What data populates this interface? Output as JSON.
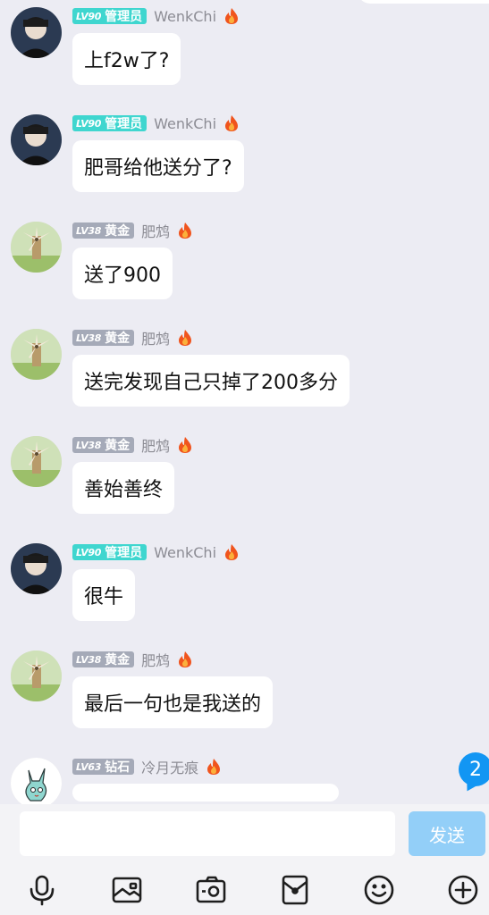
{
  "messages": [
    {
      "level": "LV90",
      "title": "管理员",
      "nickname": "WenkChi",
      "text": "上f2w了?",
      "type": "admin"
    },
    {
      "level": "LV90",
      "title": "管理员",
      "nickname": "WenkChi",
      "text": "肥哥给他送分了?",
      "type": "admin"
    },
    {
      "level": "LV38",
      "title": "黄金",
      "nickname": "肥鸩",
      "text": "送了900",
      "type": "gold"
    },
    {
      "level": "LV38",
      "title": "黄金",
      "nickname": "肥鸩",
      "text": "送完发现自己只掉了200多分",
      "type": "gold"
    },
    {
      "level": "LV38",
      "title": "黄金",
      "nickname": "肥鸩",
      "text": "善始善终",
      "type": "gold"
    },
    {
      "level": "LV90",
      "title": "管理员",
      "nickname": "WenkChi",
      "text": "很牛",
      "type": "admin"
    },
    {
      "level": "LV38",
      "title": "黄金",
      "nickname": "肥鸩",
      "text": "最后一句也是我送的",
      "type": "gold"
    },
    {
      "level": "LV63",
      "title": "钻石",
      "nickname": "冷月无痕",
      "text": "",
      "type": "diamond"
    }
  ],
  "unread_count": "2",
  "composer": {
    "input_value": "",
    "send_label": "发送"
  },
  "toolbar_icons": [
    "microphone-icon",
    "image-icon",
    "camera-icon",
    "red-packet-icon",
    "emoji-icon",
    "plus-icon"
  ],
  "colors": {
    "admin_badge": "#3fd6cf",
    "level_badge": "#a5aab8",
    "send_button": "#93cff8",
    "unread_badge": "#1296f3",
    "background": "#ececf3"
  }
}
